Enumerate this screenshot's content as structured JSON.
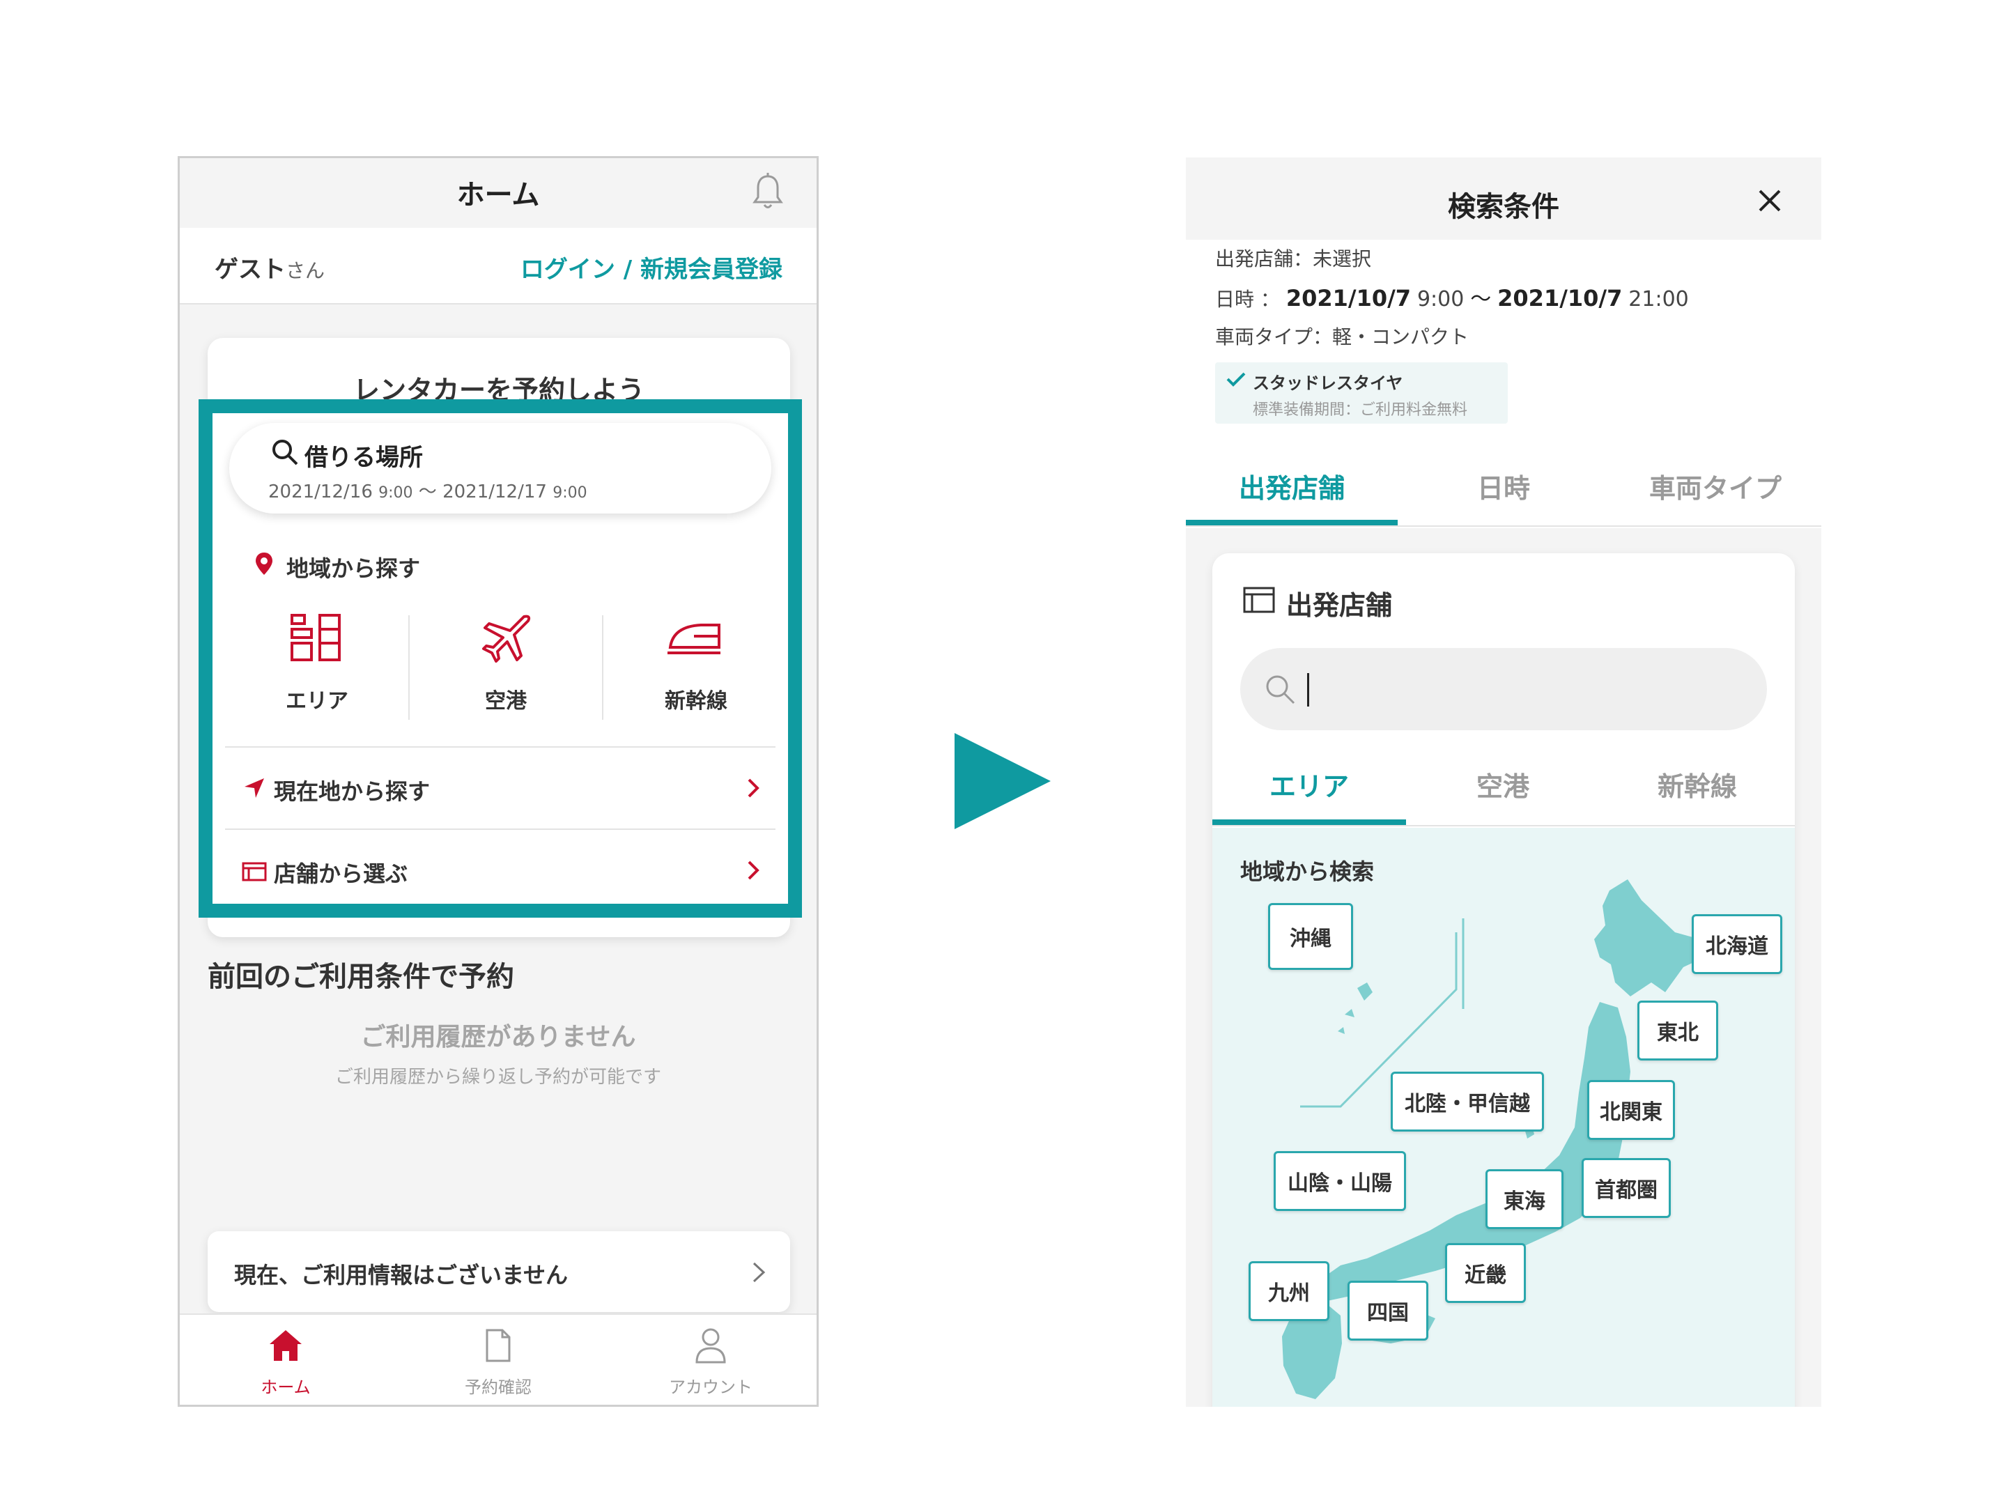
{
  "left": {
    "header": {
      "title": "ホーム",
      "bell_icon": "bell-icon"
    },
    "user_bar": {
      "name": "ゲスト",
      "suffix": "さん",
      "login_label": "ログイン / 新規会員登録"
    },
    "reserve_card": {
      "title": "レンタカーを予約しよう",
      "search": {
        "label": "借りる場所",
        "date_from": "2021/12/16",
        "time_from": "9:00",
        "tilde": "〜",
        "date_to": "2021/12/17",
        "time_to": "9:00"
      },
      "region_label": "地域から探す",
      "options": [
        {
          "label": "エリア",
          "icon": "building-icon"
        },
        {
          "label": "空港",
          "icon": "airplane-icon"
        },
        {
          "label": "新幹線",
          "icon": "bullet-train-icon"
        }
      ],
      "rows": [
        {
          "label": "現在地から探す",
          "icon": "location-arrow-icon"
        },
        {
          "label": "店舗から選ぶ",
          "icon": "store-icon"
        }
      ]
    },
    "previous": {
      "heading": "前回のご利用条件で予約",
      "empty_title": "ご利用履歴がありません",
      "empty_sub": "ご利用履歴から繰り返し予約が可能です"
    },
    "info_bar": {
      "label": "現在、ご利用情報はございません"
    },
    "bottom_nav": [
      {
        "label": "ホーム",
        "icon": "home-icon"
      },
      {
        "label": "予約確認",
        "icon": "document-icon"
      },
      {
        "label": "アカウント",
        "icon": "person-icon"
      }
    ]
  },
  "right": {
    "header": {
      "title": "検索条件",
      "close_icon": "close-icon"
    },
    "summary": {
      "store_label": "出発店舗：",
      "store_value": "未選択",
      "datetime_label": "日時 ：",
      "date_from": "2021/10/7",
      "time_from": "9:00",
      "tilde": "〜",
      "date_to": "2021/10/7",
      "time_to": "21:00",
      "vehicle_label": "車両タイプ：",
      "vehicle_value": "軽・コンパクト",
      "studless_title": "スタッドレスタイヤ",
      "studless_sub": "標準装備期間：ご利用料金無料"
    },
    "tabs": [
      "出発店舗",
      "日時",
      "車両タイプ"
    ],
    "panel": {
      "title": "出発店舗",
      "search_placeholder": "",
      "subtabs": [
        "エリア",
        "空港",
        "新幹線"
      ],
      "map_heading": "地域から検索",
      "regions": [
        "沖縄",
        "北海道",
        "東北",
        "北陸・甲信越",
        "北関東",
        "山陰・山陽",
        "東海",
        "首都圏",
        "近畿",
        "九州",
        "四国"
      ]
    }
  },
  "colors": {
    "brand_red": "#c8102e",
    "teal": "#0f9aa0",
    "map_land": "#7fcfcf",
    "map_bg": "#e9f6f6"
  }
}
